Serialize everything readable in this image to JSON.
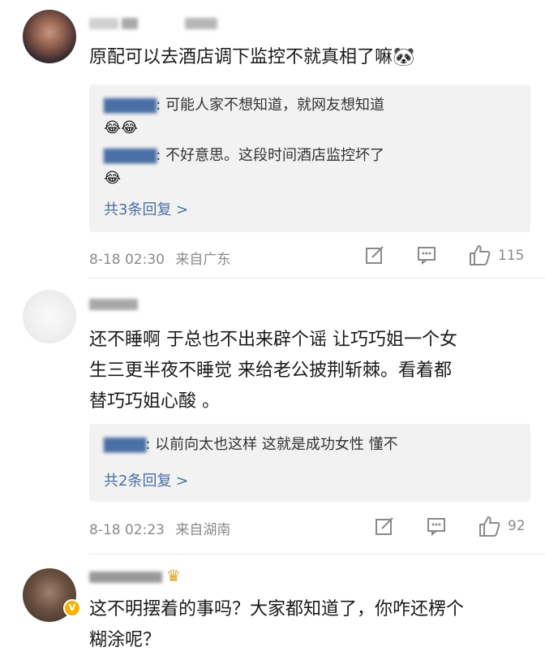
{
  "comments": [
    {
      "text": "原配可以去酒店调下监控不就真相了嘛",
      "emoji": "🐼",
      "replies": [
        {
          "name": "▇▇▇▇▇",
          "text": ": 可能人家不想知道，就网友想知道",
          "emoji": "😂😂"
        },
        {
          "name": "▇▇▇▇▇",
          "text": ": 不好意思。这段时间酒店监控坏了",
          "emoji": "😂"
        }
      ],
      "more": "共3条回复 >",
      "time": "8-18 02:30",
      "location": "来自广东",
      "likes": "115"
    },
    {
      "lines": [
        "还不睡啊 于总也不出来辟个谣 让巧巧姐一个女",
        "生三更半夜不睡觉 来给老公披荆斩棘。看着都",
        "替巧巧姐心酸 。"
      ],
      "replies": [
        {
          "name": "▇▇▇▇",
          "text": ": 以前向太也这样 这就是成功女性 懂不"
        }
      ],
      "more": "共2条回复 >",
      "time": "8-18 02:23",
      "location": "来自湖南",
      "likes": "92"
    },
    {
      "lines": [
        "这不明摆着的事吗？大家都知道了，你咋还楞个",
        "糊涂呢？"
      ],
      "badge": "V"
    }
  ]
}
